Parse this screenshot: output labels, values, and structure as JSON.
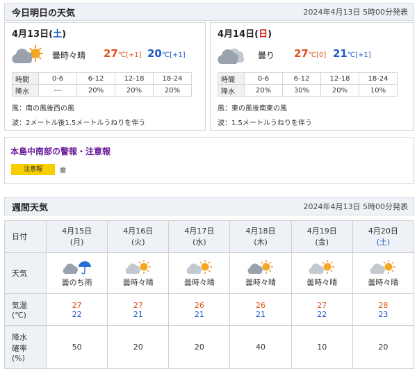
{
  "today_section": {
    "title": "今日明日の天気",
    "published": "2024年4月13日 5時00分発表"
  },
  "days": [
    {
      "date_prefix": "4月13日(",
      "weekday": "土",
      "date_suffix": ")",
      "weather": "曇時々晴",
      "icon": "cloud-sun-icon",
      "high": "27",
      "high_unit": "℃",
      "high_diff": "[+1]",
      "low": "20",
      "low_unit": "℃",
      "low_diff": "[+1]",
      "rain_label": "降水",
      "time_label": "時間",
      "periods": [
        "0-6",
        "6-12",
        "12-18",
        "18-24"
      ],
      "rain": [
        "---",
        "20%",
        "20%",
        "20%"
      ],
      "wind": "風：南の風後西の風",
      "wave": "波：2メートル後1.5メートルうねりを伴う"
    },
    {
      "date_prefix": "4月14日(",
      "weekday": "日",
      "date_suffix": ")",
      "weather": "曇り",
      "icon": "cloud-icon",
      "high": "27",
      "high_unit": "℃",
      "high_diff": "[0]",
      "low": "21",
      "low_unit": "℃",
      "low_diff": "[+1]",
      "rain_label": "降水",
      "time_label": "時間",
      "periods": [
        "0-6",
        "6-12",
        "12-18",
        "18-24"
      ],
      "rain": [
        "20%",
        "30%",
        "20%",
        "10%"
      ],
      "wind": "風：東の風後南東の風",
      "wave": "波：1.5メートルうねりを伴う"
    }
  ],
  "warning": {
    "title": "本島中南部の警報・注意報",
    "badge": "注意報",
    "kind": "雷"
  },
  "weekly_section": {
    "title": "週間天気",
    "published": "2024年4月13日 5時00分発表"
  },
  "weekly": {
    "row_labels": {
      "date": "日付",
      "weather": "天気",
      "temp_line1": "気温",
      "temp_line2": "(℃)",
      "rain_line1": "降水",
      "rain_line2": "確率",
      "rain_line3": "(%)"
    },
    "days": [
      {
        "date": "4月15日",
        "weekday": "(月)",
        "weather": "曇のち雨",
        "icon": "cloud-umbrella-icon",
        "max": "27",
        "min": "22",
        "pop": "50"
      },
      {
        "date": "4月16日",
        "weekday": "(火)",
        "weather": "曇時々晴",
        "icon": "cloud-sun-icon",
        "max": "27",
        "min": "21",
        "pop": "20"
      },
      {
        "date": "4月17日",
        "weekday": "(水)",
        "weather": "曇時々晴",
        "icon": "cloud-sun-icon",
        "max": "26",
        "min": "21",
        "pop": "20"
      },
      {
        "date": "4月18日",
        "weekday": "(木)",
        "weather": "曇時々晴",
        "icon": "cloud-sun-icon",
        "max": "26",
        "min": "21",
        "pop": "40"
      },
      {
        "date": "4月19日",
        "weekday": "(金)",
        "weather": "曇時々晴",
        "icon": "cloud-sun-icon",
        "max": "27",
        "min": "22",
        "pop": "10"
      },
      {
        "date": "4月20日",
        "weekday": "(土)",
        "weather": "曇時々晴",
        "icon": "cloud-sun-icon",
        "max": "28",
        "min": "23",
        "pop": "20"
      }
    ]
  },
  "colors": {
    "high_temp": "#e0501c",
    "low_temp": "#1f57c8",
    "saturday": "#1a56c4",
    "sunday": "#d41c1c",
    "warning_title": "#6a1b9a",
    "badge_yellow": "#f7ce00",
    "header_bg": "#eef1f6"
  }
}
